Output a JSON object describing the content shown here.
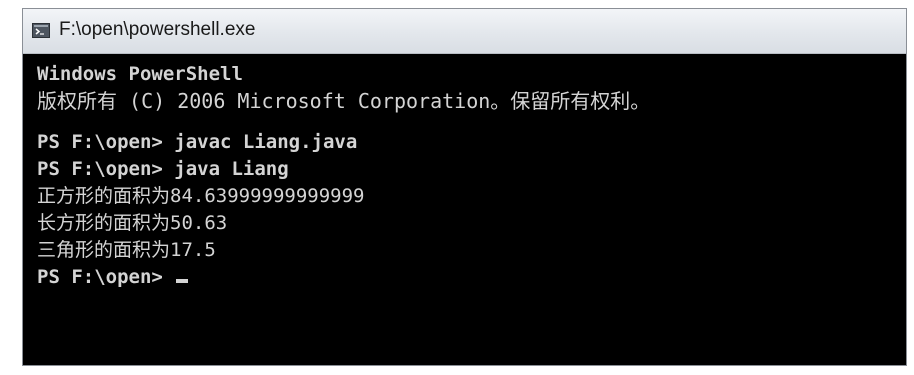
{
  "window": {
    "title": "F:\\open\\powershell.exe",
    "icon": "powershell-icon"
  },
  "console": {
    "lines": [
      "Windows PowerShell",
      "版权所有 (C) 2006 Microsoft Corporation。保留所有权利。",
      "",
      "PS F:\\open> javac Liang.java",
      "PS F:\\open> java Liang",
      "正方形的面积为84.63999999999999",
      "长方形的面积为50.63",
      "三角形的面积为17.5",
      "PS F:\\open> "
    ]
  },
  "colors": {
    "console_bg": "#000000",
    "console_text": "#d4d4d4",
    "titlebar": "#e3e7ec"
  }
}
